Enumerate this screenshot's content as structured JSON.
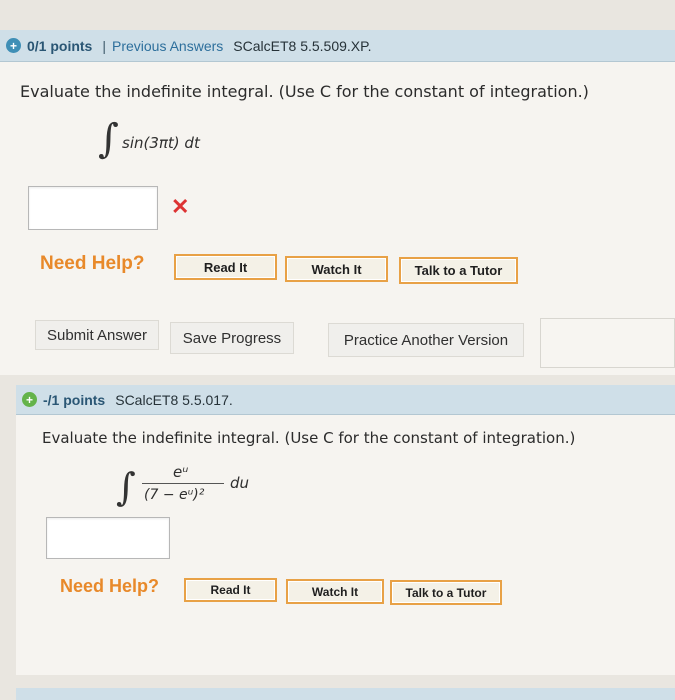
{
  "q1": {
    "points": "0/1 points",
    "separator": "|",
    "previous": "Previous Answers",
    "code": "SCalcET8 5.5.509.XP.",
    "prompt": "Evaluate the indefinite integral. (Use C for the constant of integration.)",
    "integrand": "sin(3πt) dt",
    "answer_value": "",
    "status": "incorrect"
  },
  "help1": {
    "label": "Need Help?",
    "read": "Read It",
    "watch": "Watch It",
    "tutor": "Talk to a Tutor"
  },
  "actions": {
    "submit": "Submit Answer",
    "save": "Save Progress",
    "practice": "Practice Another Version"
  },
  "q2": {
    "points": "-/1 points",
    "code": "SCalcET8 5.5.017.",
    "prompt": "Evaluate the indefinite integral. (Use C for the constant of integration.)",
    "numerator": "eᵘ",
    "denominator": "(7 − eᵘ)²",
    "differential": "du",
    "answer_value": ""
  },
  "help2": {
    "label": "Need Help?",
    "read": "Read It",
    "watch": "Watch It",
    "tutor": "Talk to a Tutor"
  },
  "colors": {
    "header_bg": "#cfdfe8",
    "help_accent": "#e8892a",
    "error": "#dd3333"
  }
}
